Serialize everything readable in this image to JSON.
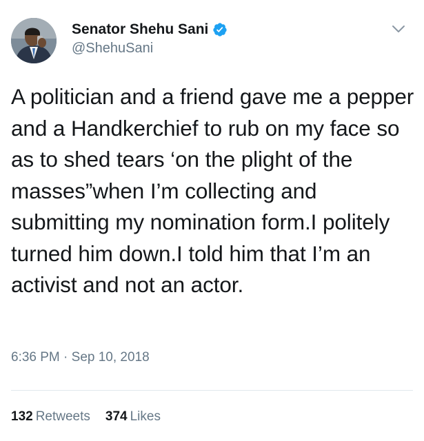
{
  "tweet": {
    "author": {
      "display_name": "Senator Shehu Sani",
      "handle": "@ShehuSani",
      "verified": true,
      "avatar_icon": "profile-photo"
    },
    "text": "A politician and a friend gave me a pepper and a Handkerchief to rub on my face so as to shed tears ‘on the plight of the masses”when I’m collecting and submitting my nomination form.I politely turned him down.I told him that I’m an activist and not an actor.",
    "time": "6:36 PM",
    "separator": "·",
    "date": "Sep 10, 2018",
    "stats": {
      "retweets_count": "132",
      "retweets_label": "Retweets",
      "likes_count": "374",
      "likes_label": "Likes"
    }
  },
  "colors": {
    "text_primary": "#14171a",
    "text_secondary": "#657786",
    "verified_blue": "#1da1f2",
    "divider": "#e1e8ed"
  },
  "icons": {
    "verified": "verified-badge-icon",
    "menu": "chevron-down-icon"
  }
}
